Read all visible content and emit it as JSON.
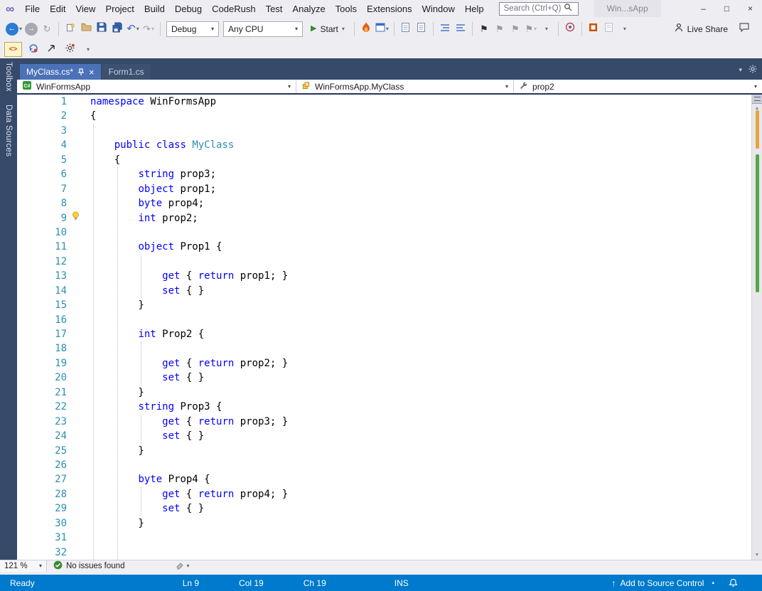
{
  "colors": {
    "accent": "#007ACC",
    "keyword": "#0000FF",
    "type_name": "#2B91AF",
    "line_number": "#2B91AF",
    "status_green": "#388A34"
  },
  "icons": {
    "caret_down": "▾",
    "caret_up": "▴",
    "play": "▶",
    "close": "×",
    "minimize": "–",
    "maximize": "□",
    "back_arrow": "←",
    "forward_arrow": "→",
    "undo": "↶",
    "redo": "↷",
    "history": "↻",
    "bookmark": "⚑",
    "scroll_up": "▲",
    "scroll_down": "▼",
    "upload_arrow": "↑",
    "infinity_logo": "∞",
    "tab_list": "▾"
  },
  "menubar": {
    "items": [
      "File",
      "Edit",
      "View",
      "Project",
      "Build",
      "Debug",
      "CodeRush",
      "Test",
      "Analyze",
      "Tools",
      "Extensions",
      "Window",
      "Help"
    ],
    "search_placeholder": "Search (Ctrl+Q)",
    "window_title": "Win...sApp"
  },
  "toolbar": {
    "solution_config": "Debug",
    "platform": "Any CPU",
    "start_label": "Start",
    "live_share_label": "Live Share"
  },
  "coderush_toolbar": {
    "logo": "<>"
  },
  "sidebar": {
    "items": [
      "Toolbox",
      "Data Sources"
    ]
  },
  "tabs": [
    {
      "label": "MyClass.cs*",
      "active": true
    },
    {
      "label": "Form1.cs",
      "active": false
    }
  ],
  "navbar": {
    "project": "WinFormsApp",
    "type": "WinFormsApp.MyClass",
    "member": "prop2"
  },
  "editor": {
    "zoom": "121 %",
    "issues_status": "No issues found",
    "lines": [
      {
        "n": 1,
        "s": [
          [
            "kw",
            "namespace"
          ],
          [
            "pl",
            " WinFormsApp"
          ]
        ]
      },
      {
        "n": 2,
        "s": [
          [
            "pl",
            "{"
          ]
        ]
      },
      {
        "n": 3,
        "s": []
      },
      {
        "n": 4,
        "s": [
          [
            "pl",
            "    "
          ],
          [
            "kw",
            "public"
          ],
          [
            "pl",
            " "
          ],
          [
            "kw",
            "class"
          ],
          [
            "pl",
            " "
          ],
          [
            "ty",
            "MyClass"
          ]
        ]
      },
      {
        "n": 5,
        "s": [
          [
            "pl",
            "    {"
          ]
        ]
      },
      {
        "n": 6,
        "s": [
          [
            "pl",
            "        "
          ],
          [
            "kw",
            "string"
          ],
          [
            "pl",
            " prop3;"
          ]
        ]
      },
      {
        "n": 7,
        "s": [
          [
            "pl",
            "        "
          ],
          [
            "kw",
            "object"
          ],
          [
            "pl",
            " prop1;"
          ]
        ]
      },
      {
        "n": 8,
        "s": [
          [
            "pl",
            "        "
          ],
          [
            "kw",
            "byte"
          ],
          [
            "pl",
            " prop4;"
          ]
        ]
      },
      {
        "n": 9,
        "s": [
          [
            "pl",
            "        "
          ],
          [
            "kw",
            "int"
          ],
          [
            "pl",
            " prop2;"
          ]
        ]
      },
      {
        "n": 10,
        "s": []
      },
      {
        "n": 11,
        "s": [
          [
            "pl",
            "        "
          ],
          [
            "kw",
            "object"
          ],
          [
            "pl",
            " Prop1 {"
          ]
        ]
      },
      {
        "n": 12,
        "s": []
      },
      {
        "n": 13,
        "s": [
          [
            "pl",
            "            "
          ],
          [
            "kw",
            "get"
          ],
          [
            "pl",
            " { "
          ],
          [
            "kw",
            "return"
          ],
          [
            "pl",
            " prop1; }"
          ]
        ]
      },
      {
        "n": 14,
        "s": [
          [
            "pl",
            "            "
          ],
          [
            "kw",
            "set"
          ],
          [
            "pl",
            " { }"
          ]
        ]
      },
      {
        "n": 15,
        "s": [
          [
            "pl",
            "        }"
          ]
        ]
      },
      {
        "n": 16,
        "s": []
      },
      {
        "n": 17,
        "s": [
          [
            "pl",
            "        "
          ],
          [
            "kw",
            "int"
          ],
          [
            "pl",
            " Prop2 {"
          ]
        ]
      },
      {
        "n": 18,
        "s": []
      },
      {
        "n": 19,
        "s": [
          [
            "pl",
            "            "
          ],
          [
            "kw",
            "get"
          ],
          [
            "pl",
            " { "
          ],
          [
            "kw",
            "return"
          ],
          [
            "pl",
            " prop2; }"
          ]
        ]
      },
      {
        "n": 20,
        "s": [
          [
            "pl",
            "            "
          ],
          [
            "kw",
            "set"
          ],
          [
            "pl",
            " { }"
          ]
        ]
      },
      {
        "n": 21,
        "s": [
          [
            "pl",
            "        }"
          ]
        ]
      },
      {
        "n": 22,
        "s": [
          [
            "pl",
            "        "
          ],
          [
            "kw",
            "string"
          ],
          [
            "pl",
            " Prop3 {"
          ]
        ]
      },
      {
        "n": 23,
        "s": [
          [
            "pl",
            "            "
          ],
          [
            "kw",
            "get"
          ],
          [
            "pl",
            " { "
          ],
          [
            "kw",
            "return"
          ],
          [
            "pl",
            " prop3; }"
          ]
        ]
      },
      {
        "n": 24,
        "s": [
          [
            "pl",
            "            "
          ],
          [
            "kw",
            "set"
          ],
          [
            "pl",
            " { }"
          ]
        ]
      },
      {
        "n": 25,
        "s": [
          [
            "pl",
            "        }"
          ]
        ]
      },
      {
        "n": 26,
        "s": []
      },
      {
        "n": 27,
        "s": [
          [
            "pl",
            "        "
          ],
          [
            "kw",
            "byte"
          ],
          [
            "pl",
            " Prop4 {"
          ]
        ]
      },
      {
        "n": 28,
        "s": [
          [
            "pl",
            "            "
          ],
          [
            "kw",
            "get"
          ],
          [
            "pl",
            " { "
          ],
          [
            "kw",
            "return"
          ],
          [
            "pl",
            " prop4; }"
          ]
        ]
      },
      {
        "n": 29,
        "s": [
          [
            "pl",
            "            "
          ],
          [
            "kw",
            "set"
          ],
          [
            "pl",
            " { }"
          ]
        ]
      },
      {
        "n": 30,
        "s": [
          [
            "pl",
            "        }"
          ]
        ]
      },
      {
        "n": 31,
        "s": []
      },
      {
        "n": 32,
        "s": []
      }
    ]
  },
  "statusbar": {
    "message": "Ready",
    "line": "Ln 9",
    "column": "Col 19",
    "character": "Ch 19",
    "mode": "INS",
    "source_control": "Add to Source Control"
  }
}
